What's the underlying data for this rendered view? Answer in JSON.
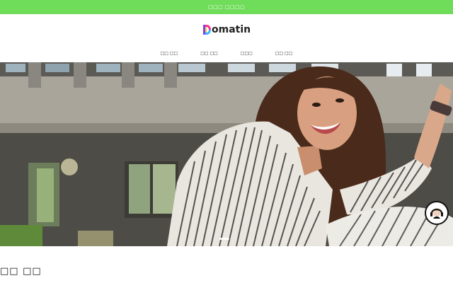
{
  "announcement": {
    "text": "□□□ □□□□"
  },
  "header": {
    "logo_text": "omatin",
    "nav": [
      {
        "label": "□□ □□"
      },
      {
        "label": "□□ □□"
      },
      {
        "label": "□□□"
      },
      {
        "label": "□□ □□"
      }
    ]
  },
  "hero": {
    "slide_index": 1,
    "slide_count": 1
  },
  "main": {
    "section_title": "□□ □□"
  },
  "colors": {
    "topbar": "#6fdc5a",
    "logo_mark": [
      "#ff2f8a",
      "#ffd21a",
      "#2fb6ff",
      "#7a3cff"
    ]
  },
  "icons": {
    "chat": "chat-support-icon",
    "logo": "logo-d-icon"
  }
}
